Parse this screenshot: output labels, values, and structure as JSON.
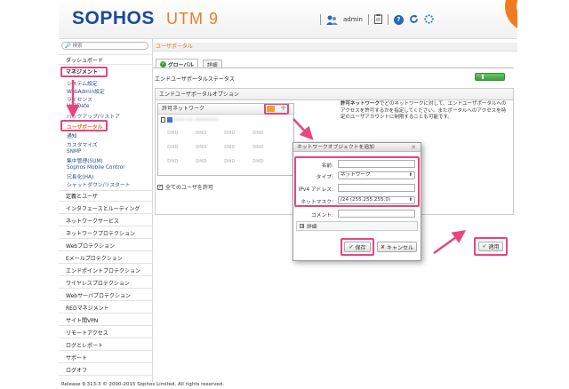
{
  "header": {
    "brand": "SOPHOS",
    "product": "UTM 9",
    "user": "admin"
  },
  "search": {
    "placeholder": "検索"
  },
  "breadcrumb": "ユーザポータル",
  "sidebar": {
    "items_top": [
      {
        "label": "ダッシュボード"
      },
      {
        "label": "マネジメント"
      }
    ],
    "subitems": [
      {
        "label": "システム設定"
      },
      {
        "label": "WebAdmin設定"
      },
      {
        "label": "ライセンス"
      },
      {
        "label": "Up2Date"
      },
      {
        "label": "バックアップ/リストア"
      },
      {
        "label": "ユーザポータル"
      },
      {
        "label": "通知"
      },
      {
        "label": "カスタマイズ"
      },
      {
        "label": "SNMP"
      },
      {
        "label": "集中管理(SUM)"
      },
      {
        "label": "Sophos Mobile Control"
      },
      {
        "label": "冗長化(HA)"
      },
      {
        "label": "シャットダウン/リスタート"
      }
    ],
    "items_bottom": [
      {
        "label": "定義とユーザ"
      },
      {
        "label": "インタフェースとルーティング"
      },
      {
        "label": "ネットワークサービス"
      },
      {
        "label": "ネットワークプロテクション"
      },
      {
        "label": "Webプロテクション"
      },
      {
        "label": "Eメールプロテクション"
      },
      {
        "label": "エンドポイントプロテクション"
      },
      {
        "label": "ワイヤレスプロテクション"
      },
      {
        "label": "Webサーバプロテクション"
      },
      {
        "label": "REDマネジメント"
      },
      {
        "label": "サイト間VPN"
      },
      {
        "label": "リモートアクセス"
      },
      {
        "label": "ログとレポート"
      },
      {
        "label": "サポート"
      },
      {
        "label": "ログオフ"
      }
    ]
  },
  "tabs": [
    {
      "label": "グローバル"
    },
    {
      "label": "詳細"
    }
  ],
  "main": {
    "status_label": "エンドユーザポータルステータス",
    "options_title": "エンドユーザポータルオプション",
    "allowed_networks_title": "許可ネットワーク",
    "allowed_network_item": "Internal (Network)",
    "dnd_text": "DND",
    "allow_all_label": "全てのユーザを許可",
    "desc_bold": "許可ネットワーク",
    "desc_text": "でどのネットワークに対して、エンドユーザポータルへのアクセスを許可するかを指定してください。またポータルへのアクセスを特定のユーザアカウントに制限することも可能です。",
    "apply_label": "適用"
  },
  "dialog": {
    "title": "ネットワークオブジェクトを追加",
    "name_label": "名前:",
    "name_value": "",
    "type_label": "タイプ:",
    "type_value": "ネットワーク",
    "ipv4_label": "IPv4 アドレス:",
    "ipv4_value": "",
    "netmask_label": "ネットマスク:",
    "netmask_value": "/24 (255.255.255.0)",
    "comment_label": "コメント:",
    "comment_value": "",
    "details_label": "詳細",
    "save_label": "保存",
    "cancel_label": "キャンセル"
  },
  "footer": "Release 9.313-3  © 2000-2015 Sophos Limited. All rights reserved.",
  "colors": {
    "highlight": "#e8457f",
    "brand_blue": "#1a4a9e",
    "accent_orange": "#f07c1e",
    "link_blue": "#2a4f8f",
    "toggle_green": "#4caf50"
  }
}
